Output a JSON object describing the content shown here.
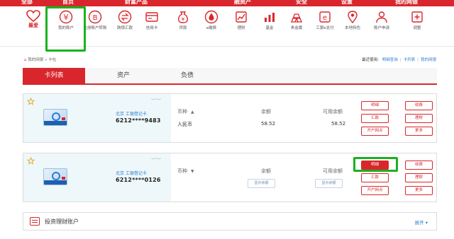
{
  "top_nav": {
    "items": [
      "全部",
      "首页",
      "财富产品",
      "",
      "融资产",
      "",
      "安全",
      "",
      "设置",
      "我的网银"
    ],
    "bg_color": "#d9262c"
  },
  "icon_bar": {
    "items": [
      {
        "label": "最爱",
        "icon": "heart-icon"
      },
      {
        "label": "我的账户",
        "icon": "yuan-coin-icon"
      },
      {
        "label": "注册账户转账",
        "icon": "b-coin-icon"
      },
      {
        "label": "跨境汇款",
        "icon": "transfer-icon"
      },
      {
        "label": "信用卡",
        "icon": "credit-card-icon"
      },
      {
        "label": "贷款",
        "icon": "money-bag-icon"
      },
      {
        "label": "e缴费",
        "icon": "water-drop-icon"
      },
      {
        "label": "理财",
        "icon": "chart-icon"
      },
      {
        "label": "基金",
        "icon": "bar-chart-icon"
      },
      {
        "label": "贵金属",
        "icon": "gold-bars-icon"
      },
      {
        "label": "工银e支付",
        "icon": "e-pay-icon"
      },
      {
        "label": "本地特色",
        "icon": "location-icon"
      },
      {
        "label": "账户申请",
        "icon": "person-icon"
      },
      {
        "label": "调整",
        "icon": "plus-square-icon"
      }
    ]
  },
  "breadcrumb": {
    "home": "我的网银",
    "sep": " » ",
    "current": "卡包"
  },
  "recent": {
    "label": "最近使用:",
    "links": [
      "明细查询",
      "卡列表",
      "我的网银"
    ]
  },
  "tabs": [
    {
      "label": "卡列表",
      "active": true
    },
    {
      "label": "资产"
    },
    {
      "label": "负债"
    }
  ],
  "cards": [
    {
      "bank": "北京  工银借记卡",
      "number": "6212****9483",
      "currency_header": "币种",
      "balance_header": "余额",
      "available_header": "可用余额",
      "currency": "人民币",
      "balance": "58.52",
      "available": "58.52",
      "buttons": [
        "明细",
        "汇款",
        "开户网点",
        "收费",
        "理财",
        "更多"
      ]
    },
    {
      "bank": "北京  工银借记卡",
      "number": "6212****0126",
      "currency_header": "币种",
      "balance_header": "余额",
      "available_header": "可用余额",
      "show_balance_label": "显示余额",
      "buttons": [
        "明细",
        "汇款",
        "开户网点",
        "收费",
        "理财",
        "更多"
      ]
    }
  ],
  "invest": {
    "title": "投资理财账户",
    "expand": "展开 ▾"
  },
  "colors": {
    "accent": "#d9262c",
    "highlight": "#19b21e",
    "link": "#2f7fcf"
  }
}
